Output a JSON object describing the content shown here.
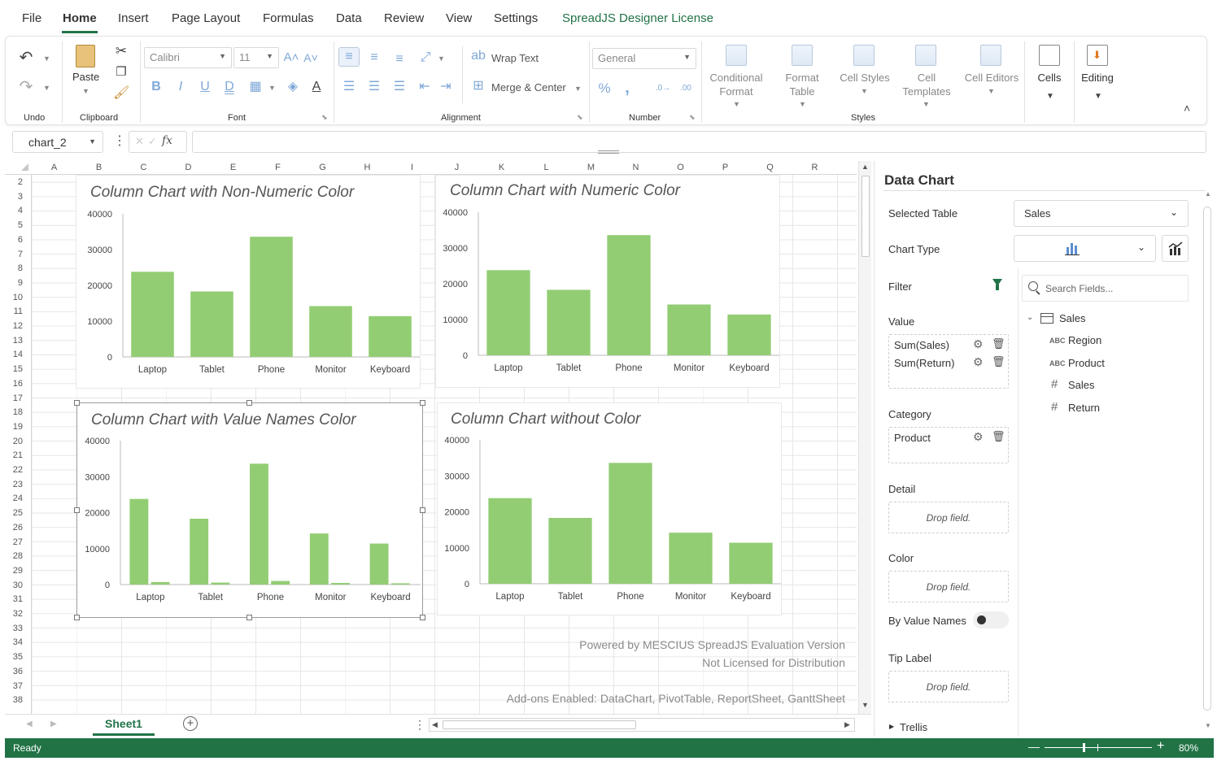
{
  "menu": {
    "file": "File",
    "home": "Home",
    "insert": "Insert",
    "page_layout": "Page Layout",
    "formulas": "Formulas",
    "data": "Data",
    "review": "Review",
    "view": "View",
    "settings": "Settings",
    "license": "SpreadJS Designer License"
  },
  "ribbon": {
    "groups": {
      "undo": "Undo",
      "clipboard": "Clipboard",
      "font": "Font",
      "alignment": "Alignment",
      "number": "Number",
      "styles": "Styles"
    },
    "paste": "Paste",
    "font_name": "Calibri",
    "font_size": "11",
    "wrap_text": "Wrap Text",
    "merge_center": "Merge & Center",
    "number_format": "General",
    "conditional_format": [
      "Conditional",
      "Format"
    ],
    "format_table": [
      "Format",
      "Table"
    ],
    "cell_styles": "Cell Styles",
    "cell_templates": [
      "Cell",
      "Templates"
    ],
    "cell_editors": "Cell Editors",
    "cells": "Cells",
    "editing": "Editing"
  },
  "formula_bar": {
    "name_box": "chart_2",
    "fx": "fx",
    "value": ""
  },
  "grid": {
    "columns": [
      "A",
      "B",
      "C",
      "D",
      "E",
      "F",
      "G",
      "H",
      "I",
      "J",
      "K",
      "L",
      "M",
      "N",
      "O",
      "P",
      "Q",
      "R"
    ],
    "rows": [
      "2",
      "3",
      "4",
      "5",
      "6",
      "7",
      "8",
      "9",
      "10",
      "11",
      "12",
      "13",
      "14",
      "15",
      "16",
      "17",
      "18",
      "19",
      "20",
      "21",
      "22",
      "23",
      "24",
      "25",
      "26",
      "27",
      "28",
      "29",
      "30",
      "31",
      "32",
      "33",
      "34",
      "35",
      "36",
      "37",
      "38"
    ]
  },
  "charts": [
    {
      "title": "Column Chart with Non-Numeric Color",
      "chart_data": {
        "type": "bar",
        "categories": [
          "Laptop",
          "Tablet",
          "Phone",
          "Monitor",
          "Keyboard"
        ],
        "series": [
          {
            "values": [
              23800,
              18300,
              33600,
              14200,
              11400
            ]
          }
        ],
        "ylim": [
          0,
          40000
        ],
        "yticks": [
          "40000",
          "30000",
          "20000",
          "10000",
          "0"
        ],
        "color": "#92cd74"
      }
    },
    {
      "title": "Column Chart with Numeric Color",
      "chart_data": {
        "type": "bar",
        "categories": [
          "Laptop",
          "Tablet",
          "Phone",
          "Monitor",
          "Keyboard"
        ],
        "series": [
          {
            "values": [
              23800,
              18300,
              33600,
              14200,
              11400
            ]
          }
        ],
        "ylim": [
          0,
          40000
        ],
        "yticks": [
          "40000",
          "30000",
          "20000",
          "10000",
          "0"
        ],
        "color": "#92cd74"
      }
    },
    {
      "title": "Column Chart with Value Names Color",
      "chart_data": {
        "type": "bar",
        "categories": [
          "Laptop",
          "Tablet",
          "Phone",
          "Monitor",
          "Keyboard"
        ],
        "series": [
          {
            "values": [
              23800,
              18300,
              33600,
              14200,
              11400
            ]
          },
          {
            "values": [
              700,
              550,
              1000,
              450,
              350
            ]
          }
        ],
        "ylim": [
          0,
          40000
        ],
        "yticks": [
          "40000",
          "30000",
          "20000",
          "10000",
          "0"
        ],
        "color": "#92cd74"
      }
    },
    {
      "title": "Column Chart without Color",
      "chart_data": {
        "type": "bar",
        "categories": [
          "Laptop",
          "Tablet",
          "Phone",
          "Monitor",
          "Keyboard"
        ],
        "series": [
          {
            "values": [
              23800,
              18300,
              33600,
              14200,
              11400
            ]
          }
        ],
        "ylim": [
          0,
          40000
        ],
        "yticks": [
          "40000",
          "30000",
          "20000",
          "10000",
          "0"
        ],
        "color": "#92cd74"
      }
    }
  ],
  "watermark": {
    "line1": "Powered by MESCIUS SpreadJS Evaluation Version",
    "line2": "Not Licensed for Distribution",
    "line3": "Add-ons Enabled: DataChart, PivotTable, ReportSheet, GanttSheet"
  },
  "sheets": {
    "active": "Sheet1"
  },
  "status": {
    "text": "Ready",
    "zoom": "80%",
    "zoom_level": 0.8
  },
  "panel": {
    "title": "Data Chart",
    "selected_table_label": "Selected Table",
    "selected_table_value": "Sales",
    "chart_type_label": "Chart Type",
    "filter_label": "Filter",
    "search_placeholder": "Search Fields...",
    "value_label": "Value",
    "values": [
      "Sum(Sales)",
      "Sum(Return)"
    ],
    "category_label": "Category",
    "categories": [
      "Product"
    ],
    "detail_label": "Detail",
    "color_label": "Color",
    "by_value_names_label": "By Value Names",
    "tip_label_label": "Tip Label",
    "drop_field": "Drop field.",
    "trellis_label": "Trellis",
    "tree": {
      "table": "Sales",
      "fields": [
        {
          "type": "ABC",
          "name": "Region"
        },
        {
          "type": "ABC",
          "name": "Product"
        },
        {
          "type": "#",
          "name": "Sales"
        },
        {
          "type": "#",
          "name": "Return"
        }
      ]
    }
  },
  "colors": {
    "accent": "#217346",
    "bar": "#92cd74"
  }
}
